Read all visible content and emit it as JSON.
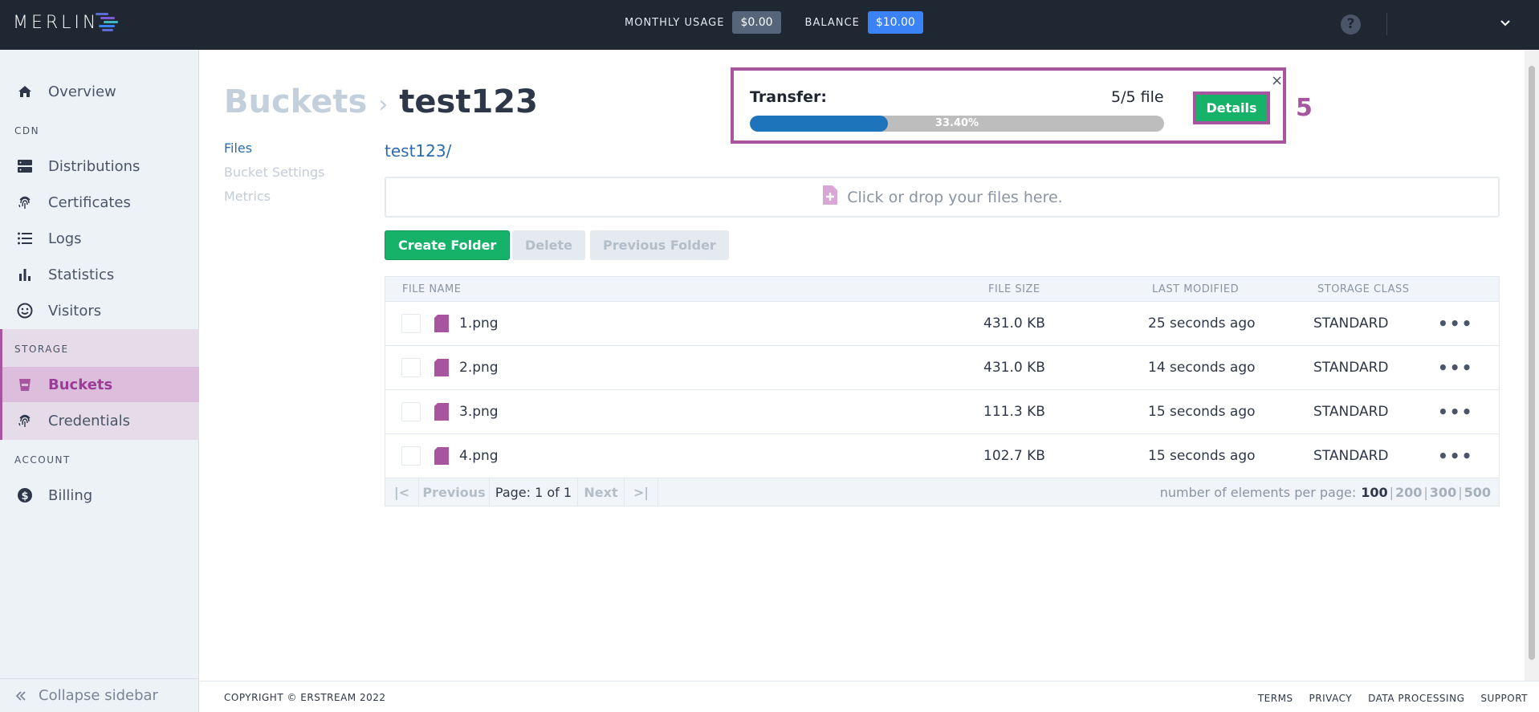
{
  "header": {
    "logo_text": "MERLIN",
    "monthly_usage_label": "MONTHLY USAGE",
    "monthly_usage_value": "$0.00",
    "balance_label": "BALANCE",
    "balance_value": "$10.00",
    "help_glyph": "?"
  },
  "sidebar": {
    "overview": "Overview",
    "section_cdn": "CDN",
    "distributions": "Distributions",
    "certificates": "Certificates",
    "logs": "Logs",
    "statistics": "Statistics",
    "visitors": "Visitors",
    "section_storage": "STORAGE",
    "buckets": "Buckets",
    "credentials": "Credentials",
    "section_account": "ACCOUNT",
    "billing": "Billing",
    "collapse": "Collapse sidebar"
  },
  "breadcrumb": {
    "parent": "Buckets",
    "separator": "›",
    "current": "test123"
  },
  "subnav": {
    "files": "Files",
    "bucket_settings": "Bucket Settings",
    "metrics": "Metrics"
  },
  "path": "test123/",
  "dropzone": "Click or drop your files here.",
  "actions": {
    "create_folder": "Create Folder",
    "delete": "Delete",
    "previous_folder": "Previous Folder"
  },
  "table": {
    "headers": {
      "name": "FILE NAME",
      "size": "FILE SIZE",
      "modified": "LAST MODIFIED",
      "storage_class": "STORAGE CLASS"
    },
    "rows": [
      {
        "name": "1.png",
        "size": "431.0 KB",
        "modified": "25 seconds ago",
        "storage_class": "STANDARD"
      },
      {
        "name": "2.png",
        "size": "431.0 KB",
        "modified": "14 seconds ago",
        "storage_class": "STANDARD"
      },
      {
        "name": "3.png",
        "size": "111.3 KB",
        "modified": "15 seconds ago",
        "storage_class": "STANDARD"
      },
      {
        "name": "4.png",
        "size": "102.7 KB",
        "modified": "15 seconds ago",
        "storage_class": "STANDARD"
      }
    ],
    "row_menu_glyph": "•••"
  },
  "pagination": {
    "first": "|<",
    "previous": "Previous",
    "page_info": "Page: 1 of 1",
    "next": "Next",
    "last": ">|",
    "per_page_label": "number of elements per page:",
    "per_page_options": [
      "100",
      "200",
      "300",
      "500"
    ],
    "per_page_selected": "100"
  },
  "transfer": {
    "label": "Transfer:",
    "count": "5/5 file",
    "progress_text": "33.40%",
    "progress_fraction": 0.334,
    "details": "Details",
    "close": "×",
    "annotation": "5"
  },
  "footer": {
    "copyright": "COPYRIGHT © ERSTREAM 2022",
    "links": [
      "TERMS",
      "PRIVACY",
      "DATA PROCESSING",
      "SUPPORT"
    ]
  },
  "colors": {
    "topbar": "#1f2733",
    "accent_purple": "#a855a0",
    "green": "#17b26a",
    "blue_link": "#2b6cb0",
    "progress_fill": "#1e74bb"
  }
}
